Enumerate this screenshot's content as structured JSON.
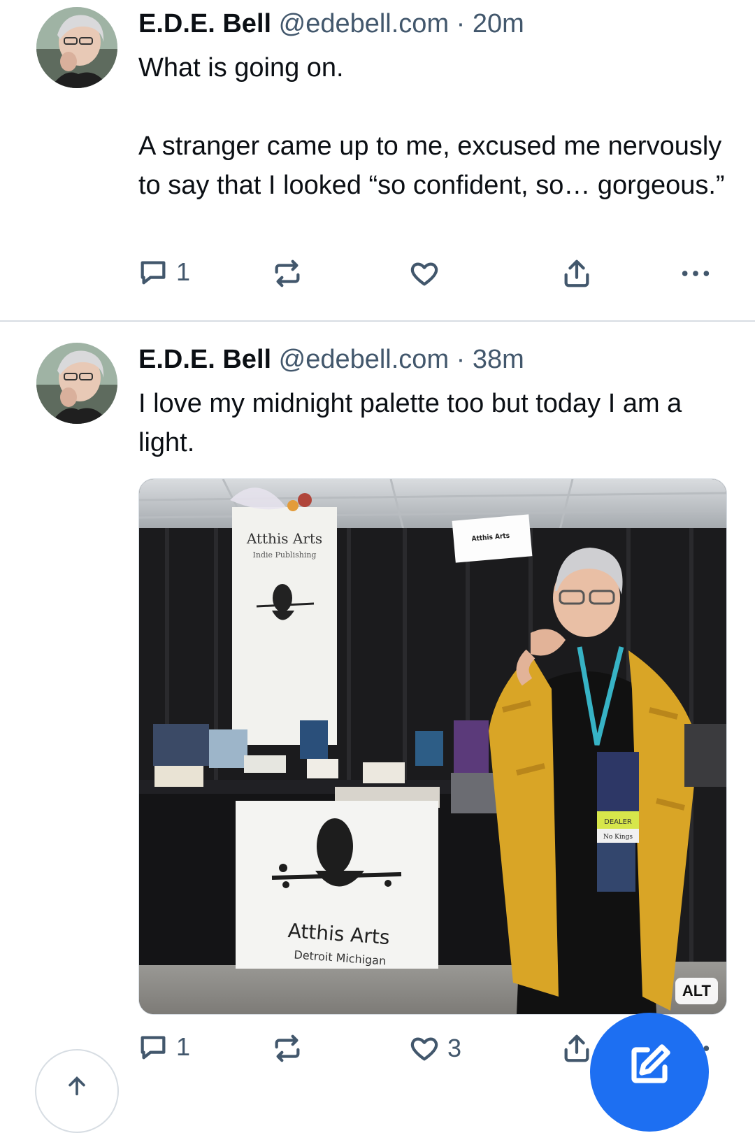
{
  "posts": [
    {
      "author_name": "E.D.E. Bell",
      "handle": "@edebell.com",
      "separator": "·",
      "time": "20m",
      "text": "What is going on.\n\nA stranger came up to me, excused me nervously to say that I looked “so confident, so… gorgeous.”",
      "reply_count": "1",
      "repost_count": "",
      "like_count": ""
    },
    {
      "author_name": "E.D.E. Bell",
      "handle": "@edebell.com",
      "separator": "·",
      "time": "38m",
      "text": "I love my midnight palette too but today I am a light.",
      "reply_count": "1",
      "repost_count": "",
      "like_count": "3",
      "image": {
        "alt_badge": "ALT",
        "banner_title": "Atthis Arts",
        "banner_subtitle": "Indie Publishing",
        "booth_sign": "Atthis Arts",
        "tablecloth_title": "Atthis Arts",
        "tablecloth_subtitle": "Detroit Michigan",
        "badge_dealer": "DEALER",
        "badge_no_kings": "No Kings"
      }
    }
  ],
  "icons": {
    "reply": "speech-bubble-icon",
    "repost": "repost-arrows-icon",
    "like": "heart-icon",
    "share": "share-upload-icon",
    "more": "ellipsis-icon",
    "compose": "compose-pencil-icon",
    "scroll_top": "arrow-up-icon"
  },
  "colors": {
    "accent": "#1d6ff2",
    "meta_text": "#42576c",
    "divider": "#d7dde3"
  }
}
